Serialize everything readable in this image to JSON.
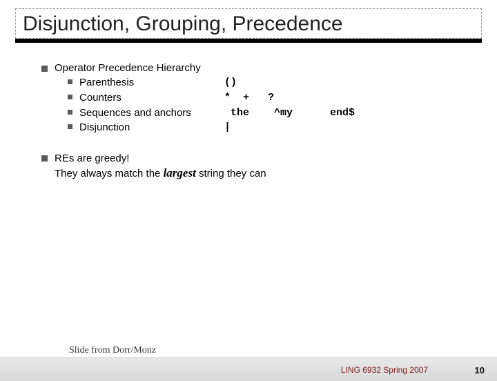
{
  "title": "Disjunction, Grouping, Precedence",
  "bullets": {
    "hierarchy_label": "Operator Precedence Hierarchy",
    "items": [
      {
        "name": "Parenthesis",
        "symbols": "()"
      },
      {
        "name": "Counters",
        "symbols": "*  +   ?"
      },
      {
        "name": "Sequences and anchors",
        "symbols": " the    ^my      end$"
      },
      {
        "name": "Disjunction",
        "symbols": "|"
      }
    ],
    "greedy_line1": "REs are greedy!",
    "greedy_line2a": "They always match the ",
    "greedy_emph": "largest",
    "greedy_line2b": " string they can"
  },
  "footer": {
    "attribution": "Slide from Dorr/Monz",
    "course": "LING 6932 Spring 2007",
    "page": "10"
  }
}
